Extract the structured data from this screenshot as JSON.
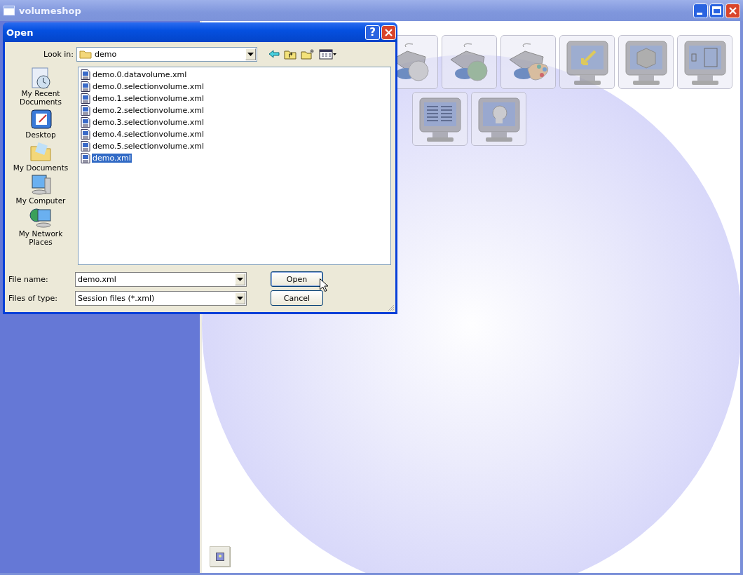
{
  "window": {
    "title": "volumeshop"
  },
  "dialog": {
    "title": "Open",
    "help_button": "?",
    "look_in": {
      "label": "Look in:",
      "value": "demo"
    },
    "places": [
      {
        "label": "My Recent Documents"
      },
      {
        "label": "Desktop"
      },
      {
        "label": "My Documents"
      },
      {
        "label": "My Computer"
      },
      {
        "label": "My Network Places"
      }
    ],
    "files": [
      {
        "name": "demo.0.datavolume.xml",
        "selected": false
      },
      {
        "name": "demo.0.selectionvolume.xml",
        "selected": false
      },
      {
        "name": "demo.1.selectionvolume.xml",
        "selected": false
      },
      {
        "name": "demo.2.selectionvolume.xml",
        "selected": false
      },
      {
        "name": "demo.3.selectionvolume.xml",
        "selected": false
      },
      {
        "name": "demo.4.selectionvolume.xml",
        "selected": false
      },
      {
        "name": "demo.5.selectionvolume.xml",
        "selected": false
      },
      {
        "name": "demo.xml",
        "selected": true
      }
    ],
    "file_name": {
      "label": "File name:",
      "value": "demo.xml"
    },
    "file_type": {
      "label": "Files of type:",
      "value": "Session files (*.xml)"
    },
    "buttons": [
      "Open",
      "Cancel"
    ]
  }
}
